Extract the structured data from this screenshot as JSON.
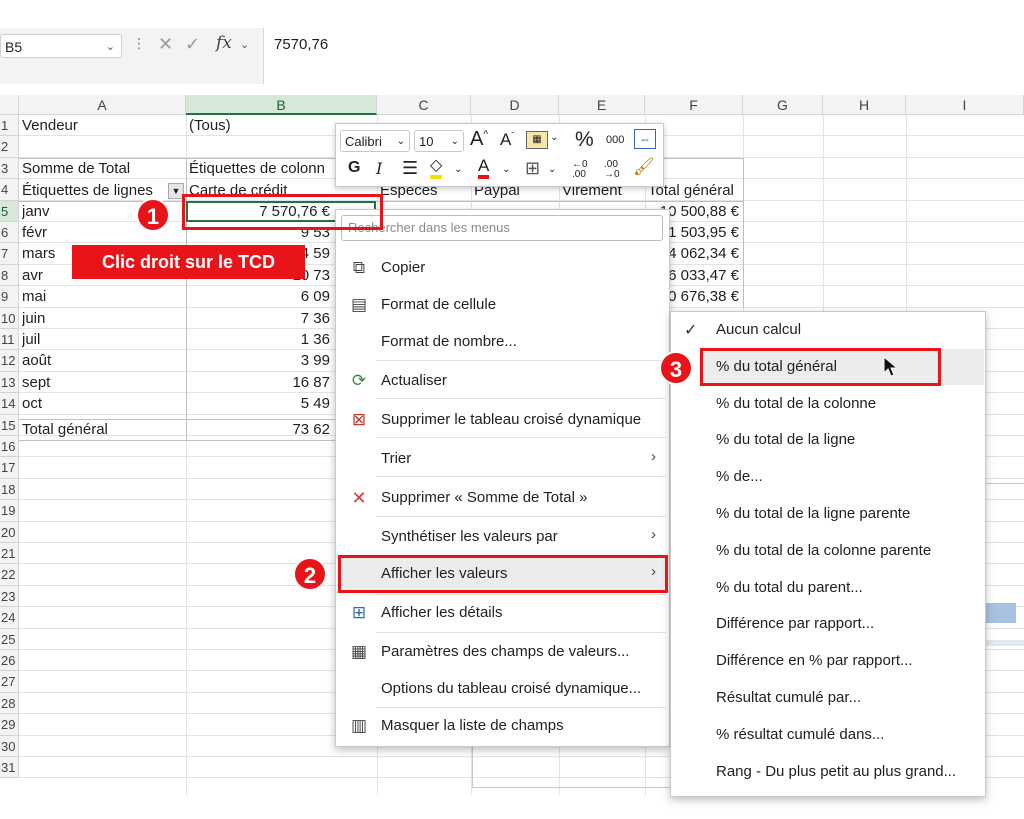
{
  "formula_bar": {
    "name_box": "B5",
    "value": "7570,76"
  },
  "columns": [
    "A",
    "B",
    "C",
    "D",
    "E",
    "F",
    "G",
    "H",
    "I"
  ],
  "rows": [
    "1",
    "2",
    "3",
    "4",
    "5",
    "6",
    "7",
    "8",
    "9",
    "10",
    "11",
    "12",
    "13",
    "14",
    "15",
    "16",
    "17",
    "18",
    "19",
    "20",
    "21",
    "22",
    "23",
    "24",
    "25",
    "26",
    "27",
    "28",
    "29",
    "30",
    "31"
  ],
  "cells": {
    "a1": "Vendeur",
    "b1": "(Tous)",
    "a3": "Somme de Total",
    "b3": "Étiquettes de colonn",
    "a4": "Étiquettes de lignes",
    "b4": "Carte de crédit",
    "c4": "Espèces",
    "d4": "Paypal",
    "e4": "Virement",
    "f4": "Total général",
    "months": [
      "janv",
      "févr",
      "mars",
      "avr",
      "mai",
      "juin",
      "juil",
      "août",
      "sept",
      "oct"
    ],
    "b_values": [
      "7 570,76 €",
      "9 53",
      "4 59",
      "10 73",
      "6 09",
      "7 36",
      "1 36",
      "3 99",
      "16 87",
      "5 49"
    ],
    "total_label": "Total général",
    "total_b": "73 62",
    "f_values": [
      "10 500,88 €",
      "1 503,95 €",
      "4 062,34 €",
      "6 033,47 €",
      "0 676,38 €"
    ]
  },
  "mini_toolbar": {
    "font_name": "Calibri",
    "font_size": "10",
    "grow_font": "A",
    "shrink_font": "A",
    "percent": "%",
    "thousands": "000",
    "bold": "G",
    "font_color_letter": "A"
  },
  "context_menu": {
    "search_placeholder": "Rechercher dans les menus",
    "items": {
      "copy": "Copier",
      "format_cell": "Format de cellule",
      "number_format": "Format de nombre...",
      "refresh": "Actualiser",
      "delete_pivot": "Supprimer le tableau croisé dynamique",
      "sort": "Trier",
      "delete_sum": "Supprimer « Somme de Total »",
      "summarize": "Synthétiser les valeurs par",
      "show_values": "Afficher les valeurs",
      "show_details": "Afficher les détails",
      "field_settings": "Paramètres des champs de valeurs...",
      "pivot_options": "Options du tableau croisé dynamique...",
      "hide_field_list": "Masquer la liste de champs"
    }
  },
  "submenu": {
    "items": [
      "Aucun calcul",
      "% du total général",
      "% du total de la colonne",
      "% du total de la ligne",
      "% de...",
      "% du total de la ligne parente",
      "% du total de la colonne parente",
      "% du total du parent...",
      "Différence par rapport...",
      "Différence en % par rapport...",
      "Résultat cumulé par...",
      "% résultat cumulé dans...",
      "Rang - Du plus petit au plus grand..."
    ],
    "checked_index": 0
  },
  "annotations": {
    "badge1": "1",
    "badge2": "2",
    "badge3": "3",
    "label": "Clic droit sur le TCD"
  },
  "colors": {
    "accent_red": "#e8141a",
    "excel_green": "#217346"
  }
}
